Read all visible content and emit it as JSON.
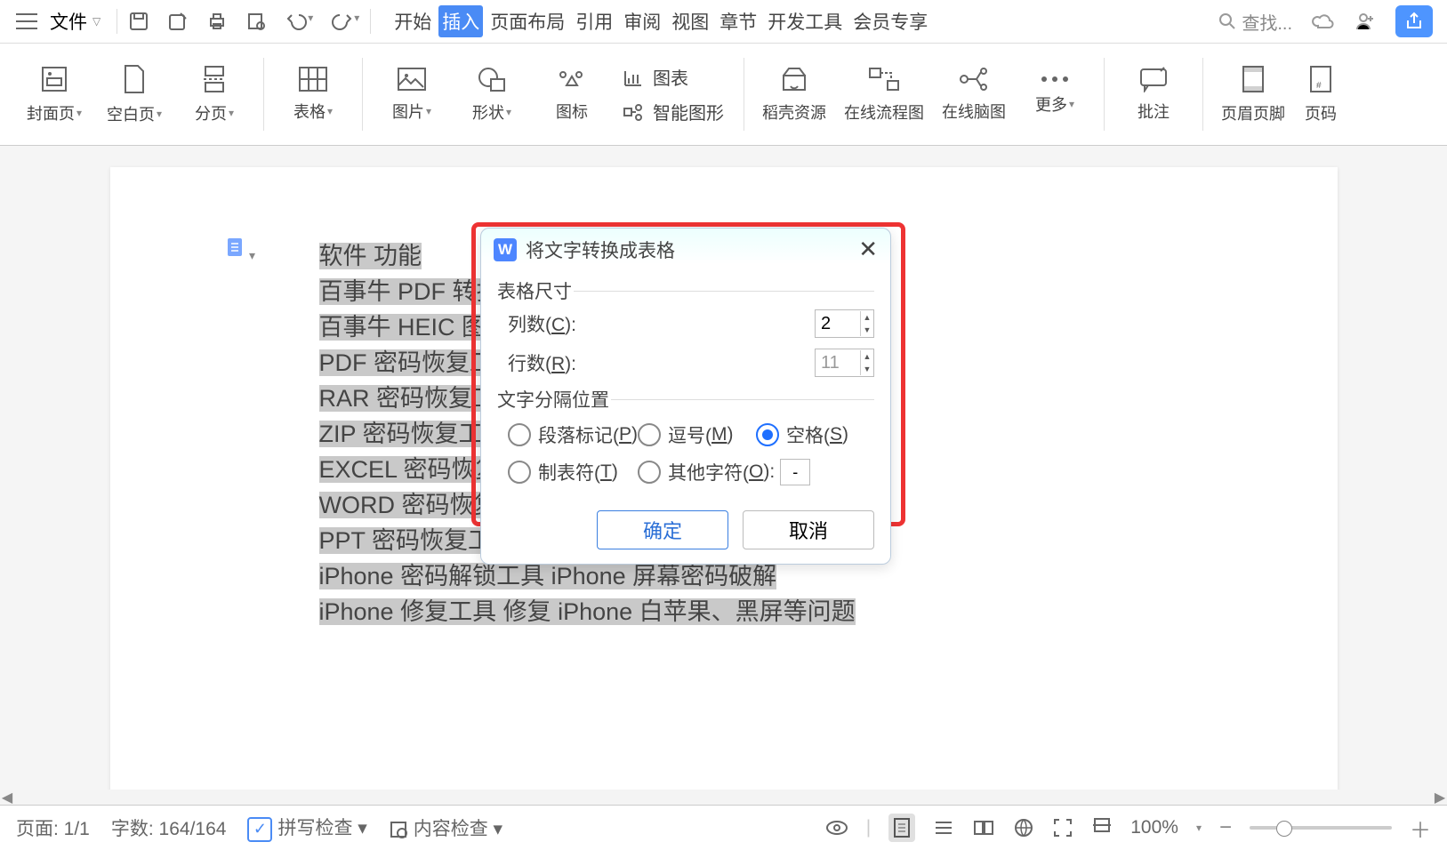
{
  "menubar": {
    "file_label": "文件",
    "tabs": [
      "开始",
      "插入",
      "页面布局",
      "引用",
      "审阅",
      "视图",
      "章节",
      "开发工具",
      "会员专享"
    ],
    "active_tab_index": 1,
    "search_placeholder": "查找..."
  },
  "ribbon": {
    "cover_page": "封面页",
    "blank_page": "空白页",
    "page_break": "分页",
    "table": "表格",
    "picture": "图片",
    "shapes": "形状",
    "icons": "图标",
    "chart": "图表",
    "smart_art": "智能图形",
    "resource": "稻壳资源",
    "flowchart": "在线流程图",
    "mindmap": "在线脑图",
    "more": "更多",
    "comment": "批注",
    "header_footer": "页眉页脚",
    "page_number": "页码"
  },
  "document": {
    "lines": [
      "软件  功能",
      "百事牛 PDF 转换工具  PDF 文",
      "百事牛 HEIC 图片专家  批量 H",
      "PDF 密码恢复工具  PDF 文档",
      "RAR 密码恢复工具 RAR 压缩",
      "ZIP 密码恢复工具  ZIP 压缩包",
      "EXCEL 密码恢复工具  ZIP 文档",
      "WORD 密码恢复工具  WORD ",
      "PPT 密码恢复工具  PPT 文档密码找回",
      "iPhone 密码解锁工具  iPhone 屏幕密码破解",
      "iPhone 修复工具  修复 iPhone 白苹果、黑屏等问题"
    ]
  },
  "dialog": {
    "title": "将文字转换成表格",
    "section_size": "表格尺寸",
    "columns_label": "列数(C):",
    "columns_value": "2",
    "rows_label": "行数(R):",
    "rows_value": "11",
    "section_sep": "文字分隔位置",
    "opt_paragraph": "段落标记(P)",
    "opt_comma": "逗号(M)",
    "opt_space": "空格(S)",
    "opt_tab": "制表符(T)",
    "opt_other": "其他字符(O):",
    "other_value": "-",
    "selected_option": "space",
    "ok": "确定",
    "cancel": "取消"
  },
  "statusbar": {
    "page": "页面: 1/1",
    "words": "字数: 164/164",
    "spellcheck": "拼写检查",
    "content_check": "内容检查",
    "zoom": "100%"
  }
}
